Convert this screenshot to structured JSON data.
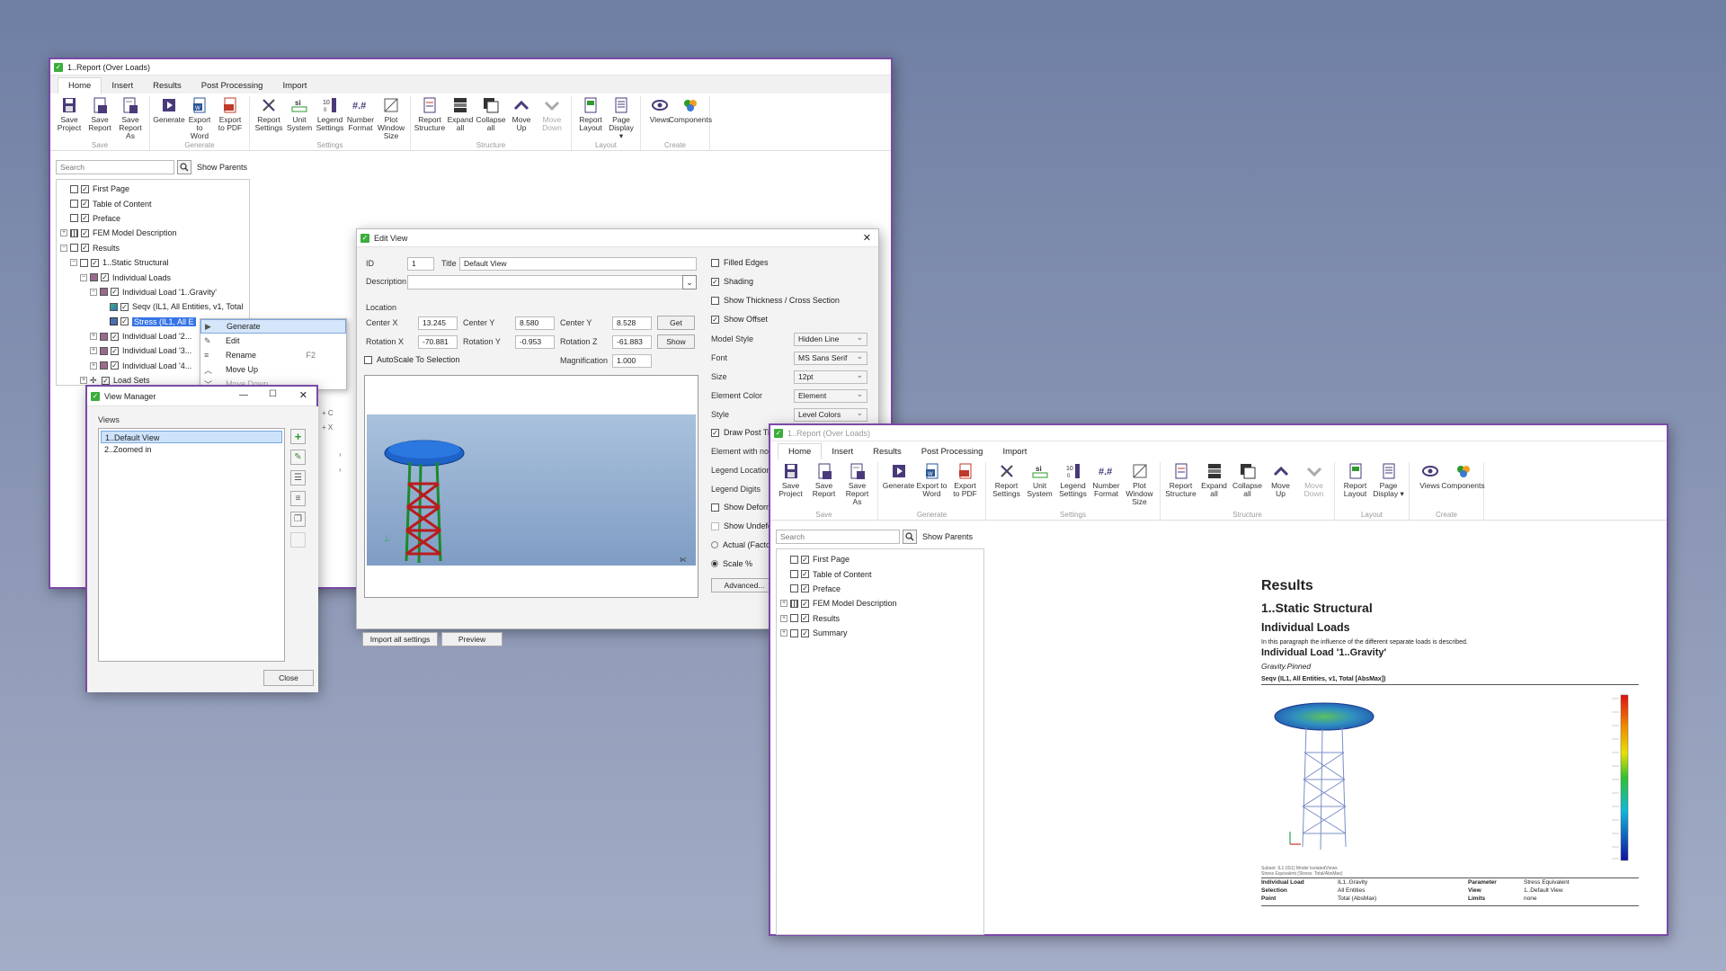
{
  "ribbon_tabs": [
    "Home",
    "Insert",
    "Results",
    "Post Processing",
    "Import"
  ],
  "ribbon_groups": [
    {
      "label": "Save",
      "buttons": [
        {
          "l1": "Save",
          "l2": "Project",
          "icon": "save-icon"
        },
        {
          "l1": "Save",
          "l2": "Report",
          "icon": "save-report-icon"
        },
        {
          "l1": "Save",
          "l2": "Report As",
          "icon": "save-as-icon"
        }
      ]
    },
    {
      "label": "Generate",
      "buttons": [
        {
          "l1": "Generate",
          "l2": "",
          "icon": "generate-icon"
        },
        {
          "l1": "Export to",
          "l2": "Word",
          "icon": "word-icon"
        },
        {
          "l1": "Export",
          "l2": "to PDF",
          "icon": "pdf-icon"
        }
      ]
    },
    {
      "label": "Settings",
      "buttons": [
        {
          "l1": "Report",
          "l2": "Settings",
          "icon": "tools-icon"
        },
        {
          "l1": "Unit",
          "l2": "System",
          "icon": "si-icon"
        },
        {
          "l1": "Legend",
          "l2": "Settings",
          "icon": "legend-icon"
        },
        {
          "l1": "Number",
          "l2": "Format",
          "icon": "number-format-icon"
        },
        {
          "l1": "Plot",
          "l2": "Window Size",
          "icon": "plot-window-icon"
        }
      ]
    },
    {
      "label": "Structure",
      "buttons": [
        {
          "l1": "Report",
          "l2": "Structure",
          "icon": "structure-icon"
        },
        {
          "l1": "Expand",
          "l2": "all",
          "icon": "expand-icon"
        },
        {
          "l1": "Collapse",
          "l2": "all",
          "icon": "collapse-icon"
        },
        {
          "l1": "Move",
          "l2": "Up",
          "icon": "up-icon"
        },
        {
          "l1": "Move",
          "l2": "Down",
          "icon": "down-icon",
          "disabled": true
        }
      ]
    },
    {
      "label": "Layout",
      "buttons": [
        {
          "l1": "Report",
          "l2": "Layout",
          "icon": "layout-icon"
        },
        {
          "l1": "Page",
          "l2": "Display ▾",
          "icon": "page-icon"
        }
      ]
    },
    {
      "label": "Create",
      "buttons": [
        {
          "l1": "Views",
          "l2": "",
          "icon": "eye-icon"
        },
        {
          "l1": "Components",
          "l2": "",
          "icon": "components-icon"
        }
      ]
    }
  ],
  "search_placeholder": "Search",
  "show_parents": "Show Parents",
  "win1": {
    "title": "1..Report (Over Loads)",
    "tree": [
      {
        "label": "First Page",
        "level": 0,
        "exp": "",
        "icon": "page"
      },
      {
        "label": "Table of Content",
        "level": 0,
        "exp": "",
        "icon": "page"
      },
      {
        "label": "Preface",
        "level": 0,
        "exp": "",
        "icon": "page"
      },
      {
        "label": "FEM Model Description",
        "level": 0,
        "exp": "+",
        "icon": "grid"
      },
      {
        "label": "Results",
        "level": 0,
        "exp": "−",
        "icon": "page"
      },
      {
        "label": "1..Static Structural",
        "level": 1,
        "exp": "−",
        "icon": "page"
      },
      {
        "label": "Individual Loads",
        "level": 2,
        "exp": "−",
        "icon": "stack"
      },
      {
        "label": "Individual Load '1..Gravity'",
        "level": 3,
        "exp": "−",
        "icon": "stack"
      },
      {
        "label": "Seqv (IL1, All Entities, v1, Total",
        "level": 4,
        "exp": "",
        "icon": "map"
      },
      {
        "label": "Stress (IL1, All E",
        "level": 4,
        "exp": "",
        "icon": "chart",
        "selected": true
      },
      {
        "label": "Individual Load '2...",
        "level": 3,
        "exp": "+",
        "icon": "stack"
      },
      {
        "label": "Individual Load '3...",
        "level": 3,
        "exp": "+",
        "icon": "stack"
      },
      {
        "label": "Individual Load '4...",
        "level": 3,
        "exp": "+",
        "icon": "stack"
      },
      {
        "label": "Load Sets",
        "level": 2,
        "exp": "+",
        "icon": "cross"
      }
    ],
    "context_menu": [
      {
        "icon": "▶",
        "label": "Generate",
        "shortcut": "",
        "hl": true
      },
      {
        "icon": "✎",
        "label": "Edit",
        "shortcut": ""
      },
      {
        "icon": "≡",
        "label": "Rename",
        "shortcut": "F2"
      },
      {
        "icon": "︿",
        "label": "Move Up",
        "shortcut": ""
      },
      {
        "icon": "﹀",
        "label": "Move Down",
        "shortcut": "",
        "dim": true
      }
    ],
    "ctx_extra": [
      "+ C",
      "+ X",
      "›",
      "›"
    ]
  },
  "view_manager": {
    "title": "View Manager",
    "views_label": "Views",
    "views": [
      "1..Default View",
      "2..Zoomed in"
    ],
    "close": "Close"
  },
  "edit_view": {
    "title": "Edit View",
    "id_label": "ID",
    "id": "1",
    "title_label": "Title",
    "title_value": "Default View",
    "desc_label": "Description",
    "location": "Location",
    "cx_l": "Center X",
    "cx": "13.245",
    "cy_l": "Center Y",
    "cy": "8.580",
    "cz_l": "Center Y",
    "cz": "8.528",
    "get": "Get",
    "rx_l": "Rotation X",
    "rx": "-70.881",
    "ry_l": "Rotation Y",
    "ry": "-0.953",
    "rz_l": "Rotation Z",
    "rz": "-61.883",
    "show": "Show",
    "autoscale": "AutoScale To Selection",
    "mag_l": "Magnification",
    "mag": "1.000",
    "import_all": "Import all settings",
    "preview": "Preview",
    "right": {
      "filled": "Filled Edges",
      "shading": "Shading",
      "thickness": "Show Thickness / Cross Section",
      "offset": "Show Offset",
      "model_style_l": "Model Style",
      "model_style": "Hidden Line",
      "font_l": "Font",
      "font": "MS Sans Serif",
      "size_l": "Size",
      "size": "12pt",
      "elem_color_l": "Element Color",
      "elem_color": "Element",
      "style_l": "Style",
      "style": "Level Colors",
      "draw_post": "Draw Post Titl",
      "elem_with": "Element with no",
      "legend_loc": "Legend Location",
      "legend_dig": "Legend Digits",
      "show_deform": "Show Deform",
      "show_undef": "Show Undefo",
      "actual": "Actual (Factor",
      "scale": "Scale %",
      "advanced": "Advanced..."
    }
  },
  "win2": {
    "title": "1..Report (Over Loads)",
    "tree": [
      {
        "label": "First Page",
        "exp": "",
        "icon": "page"
      },
      {
        "label": "Table of Content",
        "exp": "",
        "icon": "page"
      },
      {
        "label": "Preface",
        "exp": "",
        "icon": "page"
      },
      {
        "label": "FEM Model Description",
        "exp": "+",
        "icon": "grid"
      },
      {
        "label": "Results",
        "exp": "+",
        "icon": "page"
      },
      {
        "label": "Summary",
        "exp": "+",
        "icon": "page"
      }
    ],
    "doc": {
      "h1": "Results",
      "h2": "1..Static Structural",
      "h3": "Individual Loads",
      "para": "In this paragraph the influence of the different separate loads is described.",
      "h4": "Individual Load '1..Gravity'",
      "italic": "Gravity.Pinned",
      "caption": "Seqv (IL1, All Entities, v1, Total [AbsMax])",
      "footnote": "Subset: IL1 (IS1) Model IsolatedViews\nStress Equivalent (Stress: Total/AbsMax)",
      "table": [
        [
          "Individual Load",
          "IL1..Gravity",
          "Parameter",
          "Stress Equivalent"
        ],
        [
          "Selection",
          "All Entities",
          "View",
          "1..Default View"
        ],
        [
          "Point",
          "Total (AbsMax)",
          "Limits",
          "none"
        ]
      ]
    }
  },
  "colors": {
    "accent": "#7a4aa8",
    "selection": "#3574e6",
    "ribbon_purple": "#4a3a7a",
    "ribbon_red": "#c0392b"
  }
}
